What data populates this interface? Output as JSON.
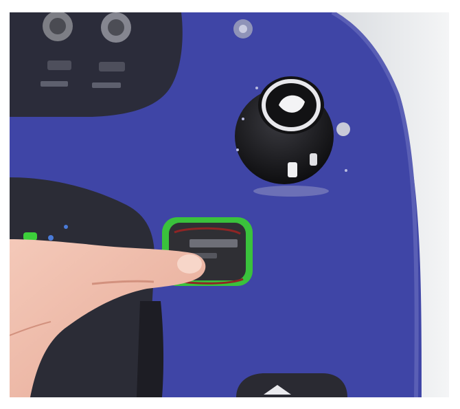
{
  "scene": {
    "subject": "control panel",
    "colors": {
      "panel_blue": "#3f45a6",
      "backdrop_white": "#eceef0",
      "button_ring": "#39c23c",
      "button_body": "#2f2f34",
      "knob_black": "#17171a",
      "status_green": "#3ccf3a"
    },
    "icons": [
      "rotary-knob-icon",
      "play-triangle-icon",
      "pointing-finger-icon",
      "connector-port-icon"
    ]
  }
}
